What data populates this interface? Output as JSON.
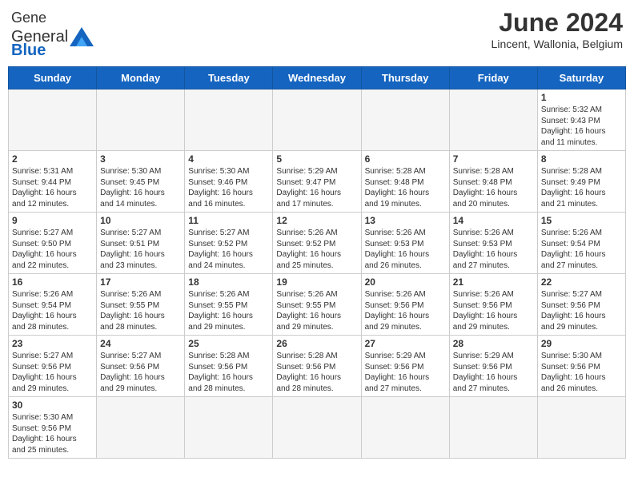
{
  "header": {
    "logo_general": "General",
    "logo_blue": "Blue",
    "title": "June 2024",
    "subtitle": "Lincent, Wallonia, Belgium"
  },
  "days_of_week": [
    "Sunday",
    "Monday",
    "Tuesday",
    "Wednesday",
    "Thursday",
    "Friday",
    "Saturday"
  ],
  "weeks": [
    [
      {
        "day": "",
        "info": "",
        "empty": true
      },
      {
        "day": "",
        "info": "",
        "empty": true
      },
      {
        "day": "",
        "info": "",
        "empty": true
      },
      {
        "day": "",
        "info": "",
        "empty": true
      },
      {
        "day": "",
        "info": "",
        "empty": true
      },
      {
        "day": "",
        "info": "",
        "empty": true
      },
      {
        "day": "1",
        "info": "Sunrise: 5:32 AM\nSunset: 9:43 PM\nDaylight: 16 hours\nand 11 minutes."
      }
    ],
    [
      {
        "day": "2",
        "info": "Sunrise: 5:31 AM\nSunset: 9:44 PM\nDaylight: 16 hours\nand 12 minutes."
      },
      {
        "day": "3",
        "info": "Sunrise: 5:30 AM\nSunset: 9:45 PM\nDaylight: 16 hours\nand 14 minutes."
      },
      {
        "day": "4",
        "info": "Sunrise: 5:30 AM\nSunset: 9:46 PM\nDaylight: 16 hours\nand 16 minutes."
      },
      {
        "day": "5",
        "info": "Sunrise: 5:29 AM\nSunset: 9:47 PM\nDaylight: 16 hours\nand 17 minutes."
      },
      {
        "day": "6",
        "info": "Sunrise: 5:28 AM\nSunset: 9:48 PM\nDaylight: 16 hours\nand 19 minutes."
      },
      {
        "day": "7",
        "info": "Sunrise: 5:28 AM\nSunset: 9:48 PM\nDaylight: 16 hours\nand 20 minutes."
      },
      {
        "day": "8",
        "info": "Sunrise: 5:28 AM\nSunset: 9:49 PM\nDaylight: 16 hours\nand 21 minutes."
      }
    ],
    [
      {
        "day": "9",
        "info": "Sunrise: 5:27 AM\nSunset: 9:50 PM\nDaylight: 16 hours\nand 22 minutes."
      },
      {
        "day": "10",
        "info": "Sunrise: 5:27 AM\nSunset: 9:51 PM\nDaylight: 16 hours\nand 23 minutes."
      },
      {
        "day": "11",
        "info": "Sunrise: 5:27 AM\nSunset: 9:52 PM\nDaylight: 16 hours\nand 24 minutes."
      },
      {
        "day": "12",
        "info": "Sunrise: 5:26 AM\nSunset: 9:52 PM\nDaylight: 16 hours\nand 25 minutes."
      },
      {
        "day": "13",
        "info": "Sunrise: 5:26 AM\nSunset: 9:53 PM\nDaylight: 16 hours\nand 26 minutes."
      },
      {
        "day": "14",
        "info": "Sunrise: 5:26 AM\nSunset: 9:53 PM\nDaylight: 16 hours\nand 27 minutes."
      },
      {
        "day": "15",
        "info": "Sunrise: 5:26 AM\nSunset: 9:54 PM\nDaylight: 16 hours\nand 27 minutes."
      }
    ],
    [
      {
        "day": "16",
        "info": "Sunrise: 5:26 AM\nSunset: 9:54 PM\nDaylight: 16 hours\nand 28 minutes."
      },
      {
        "day": "17",
        "info": "Sunrise: 5:26 AM\nSunset: 9:55 PM\nDaylight: 16 hours\nand 28 minutes."
      },
      {
        "day": "18",
        "info": "Sunrise: 5:26 AM\nSunset: 9:55 PM\nDaylight: 16 hours\nand 29 minutes."
      },
      {
        "day": "19",
        "info": "Sunrise: 5:26 AM\nSunset: 9:55 PM\nDaylight: 16 hours\nand 29 minutes."
      },
      {
        "day": "20",
        "info": "Sunrise: 5:26 AM\nSunset: 9:56 PM\nDaylight: 16 hours\nand 29 minutes."
      },
      {
        "day": "21",
        "info": "Sunrise: 5:26 AM\nSunset: 9:56 PM\nDaylight: 16 hours\nand 29 minutes."
      },
      {
        "day": "22",
        "info": "Sunrise: 5:27 AM\nSunset: 9:56 PM\nDaylight: 16 hours\nand 29 minutes."
      }
    ],
    [
      {
        "day": "23",
        "info": "Sunrise: 5:27 AM\nSunset: 9:56 PM\nDaylight: 16 hours\nand 29 minutes."
      },
      {
        "day": "24",
        "info": "Sunrise: 5:27 AM\nSunset: 9:56 PM\nDaylight: 16 hours\nand 29 minutes."
      },
      {
        "day": "25",
        "info": "Sunrise: 5:28 AM\nSunset: 9:56 PM\nDaylight: 16 hours\nand 28 minutes."
      },
      {
        "day": "26",
        "info": "Sunrise: 5:28 AM\nSunset: 9:56 PM\nDaylight: 16 hours\nand 28 minutes."
      },
      {
        "day": "27",
        "info": "Sunrise: 5:29 AM\nSunset: 9:56 PM\nDaylight: 16 hours\nand 27 minutes."
      },
      {
        "day": "28",
        "info": "Sunrise: 5:29 AM\nSunset: 9:56 PM\nDaylight: 16 hours\nand 27 minutes."
      },
      {
        "day": "29",
        "info": "Sunrise: 5:30 AM\nSunset: 9:56 PM\nDaylight: 16 hours\nand 26 minutes."
      }
    ],
    [
      {
        "day": "30",
        "info": "Sunrise: 5:30 AM\nSunset: 9:56 PM\nDaylight: 16 hours\nand 25 minutes."
      },
      {
        "day": "",
        "info": "",
        "empty": true
      },
      {
        "day": "",
        "info": "",
        "empty": true
      },
      {
        "day": "",
        "info": "",
        "empty": true
      },
      {
        "day": "",
        "info": "",
        "empty": true
      },
      {
        "day": "",
        "info": "",
        "empty": true
      },
      {
        "day": "",
        "info": "",
        "empty": true
      }
    ]
  ]
}
